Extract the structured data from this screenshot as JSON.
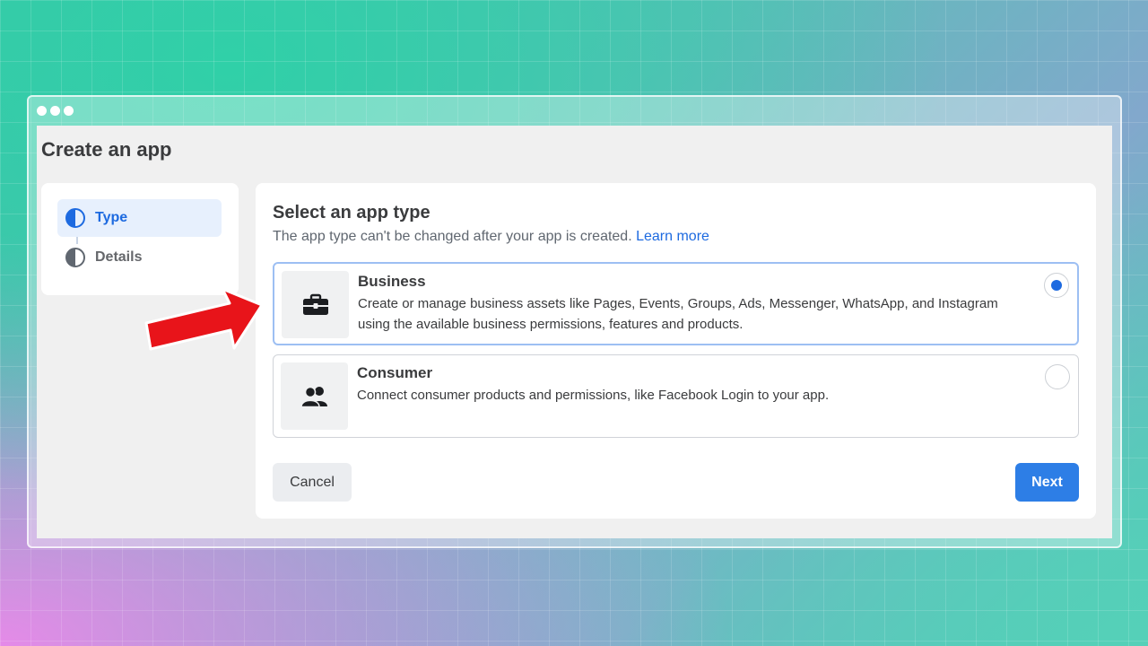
{
  "window": {
    "title": "Create an app"
  },
  "steps": [
    {
      "label": "Type",
      "active": true
    },
    {
      "label": "Details",
      "active": false
    }
  ],
  "panel": {
    "title": "Select an app type",
    "subtitle": "The app type can't be changed after your app is created.",
    "learn_more": "Learn more"
  },
  "options": [
    {
      "name": "Business",
      "icon": "briefcase-icon",
      "selected": true,
      "description": "Create or manage business assets like Pages, Events, Groups, Ads, Messenger, WhatsApp, and Instagram using the available business permissions, features and products."
    },
    {
      "name": "Consumer",
      "icon": "people-icon",
      "selected": false,
      "description": "Connect consumer products and permissions, like Facebook Login to your app."
    }
  ],
  "buttons": {
    "cancel": "Cancel",
    "next": "Next"
  },
  "colors": {
    "accent": "#1d6ae0",
    "next_button": "#2d7ee6",
    "arrow": "#e8141a"
  },
  "annotation": {
    "icon": "red-arrow-icon"
  }
}
